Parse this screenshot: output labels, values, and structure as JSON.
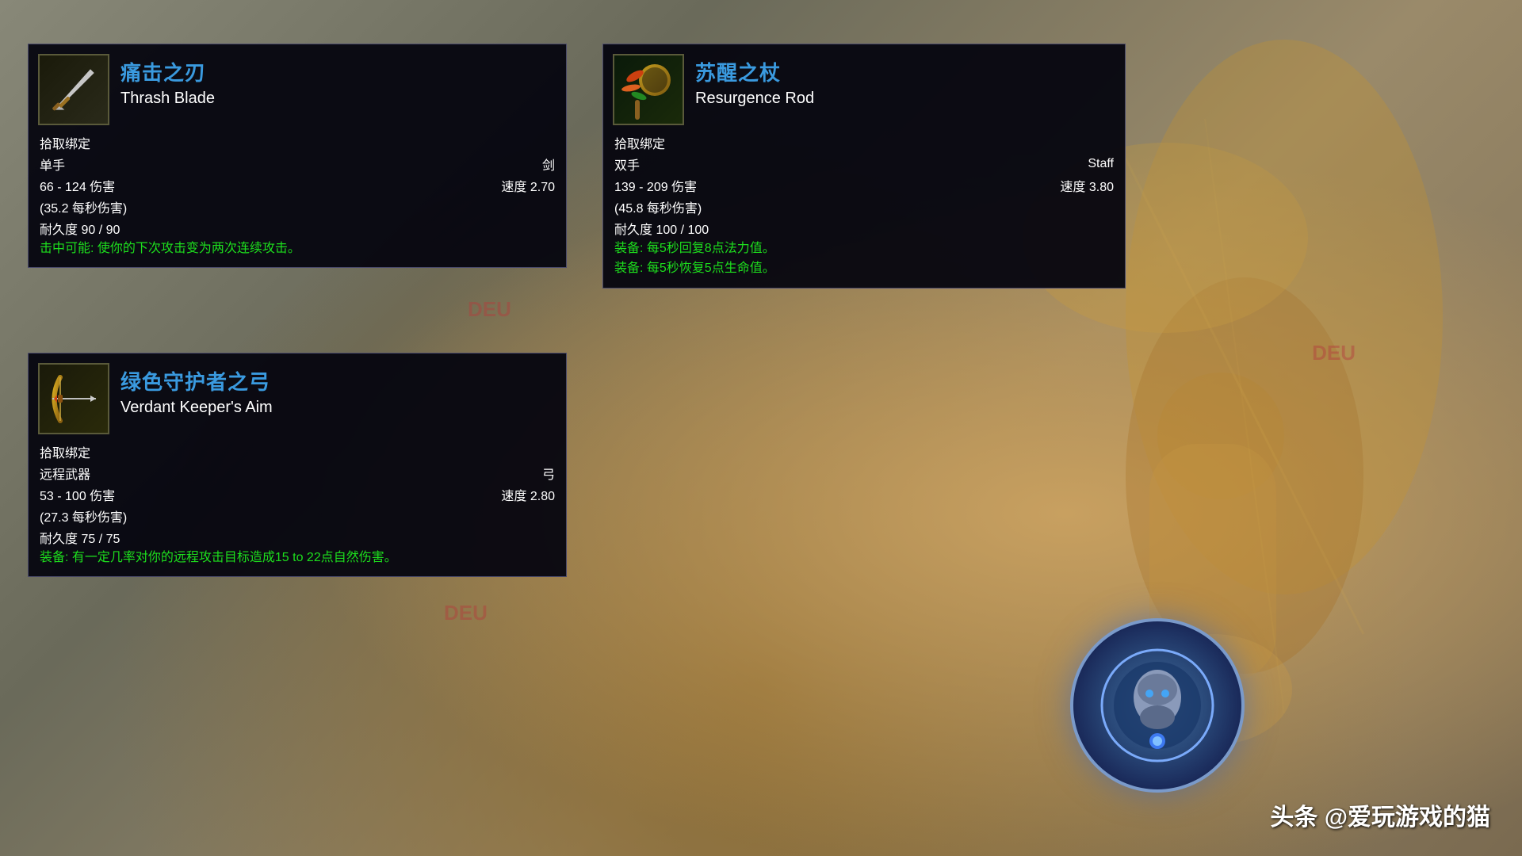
{
  "background": {
    "color": "#6a6a5a"
  },
  "items": [
    {
      "id": "thrash-blade",
      "name_cn": "痛击之刃",
      "name_en": "Thrash Blade",
      "bind": "拾取绑定",
      "hand": "单手",
      "type": "剑",
      "damage": "66 - 124 伤害",
      "speed_label": "速度 2.70",
      "dps": "(35.2 每秒伤害)",
      "durability": "耐久度 90 / 90",
      "equip": "击中可能: 使你的下次攻击变为两次连续攻击。",
      "icon_label": "⚔"
    },
    {
      "id": "resurgence-rod",
      "name_cn": "苏醒之杖",
      "name_en": "Resurgence Rod",
      "bind": "拾取绑定",
      "hand": "双手",
      "type": "Staff",
      "damage": "139 - 209 伤害",
      "speed_label": "速度 3.80",
      "dps": "(45.8 每秒伤害)",
      "durability": "耐久度 100 / 100",
      "equip1": "装备: 每5秒回复8点法力值。",
      "equip2": "装备: 每5秒恢复5点生命值。",
      "icon_label": "🌿"
    },
    {
      "id": "verdant-bow",
      "name_cn": "绿色守护者之弓",
      "name_en": "Verdant Keeper's Aim",
      "bind": "拾取绑定",
      "hand": "远程武器",
      "type": "弓",
      "damage": "53 - 100 伤害",
      "speed_label": "速度 2.80",
      "dps": "(27.3 每秒伤害)",
      "durability": "耐久度 75 / 75",
      "equip": "装备: 有一定几率对你的远程攻击目标造成15 to 22点自然伤害。",
      "icon_label": "🏹"
    }
  ],
  "footer": {
    "text": "头条 @爱玩游戏的猫"
  },
  "watermarks": [
    "DEU",
    "DEU",
    "DEU"
  ]
}
